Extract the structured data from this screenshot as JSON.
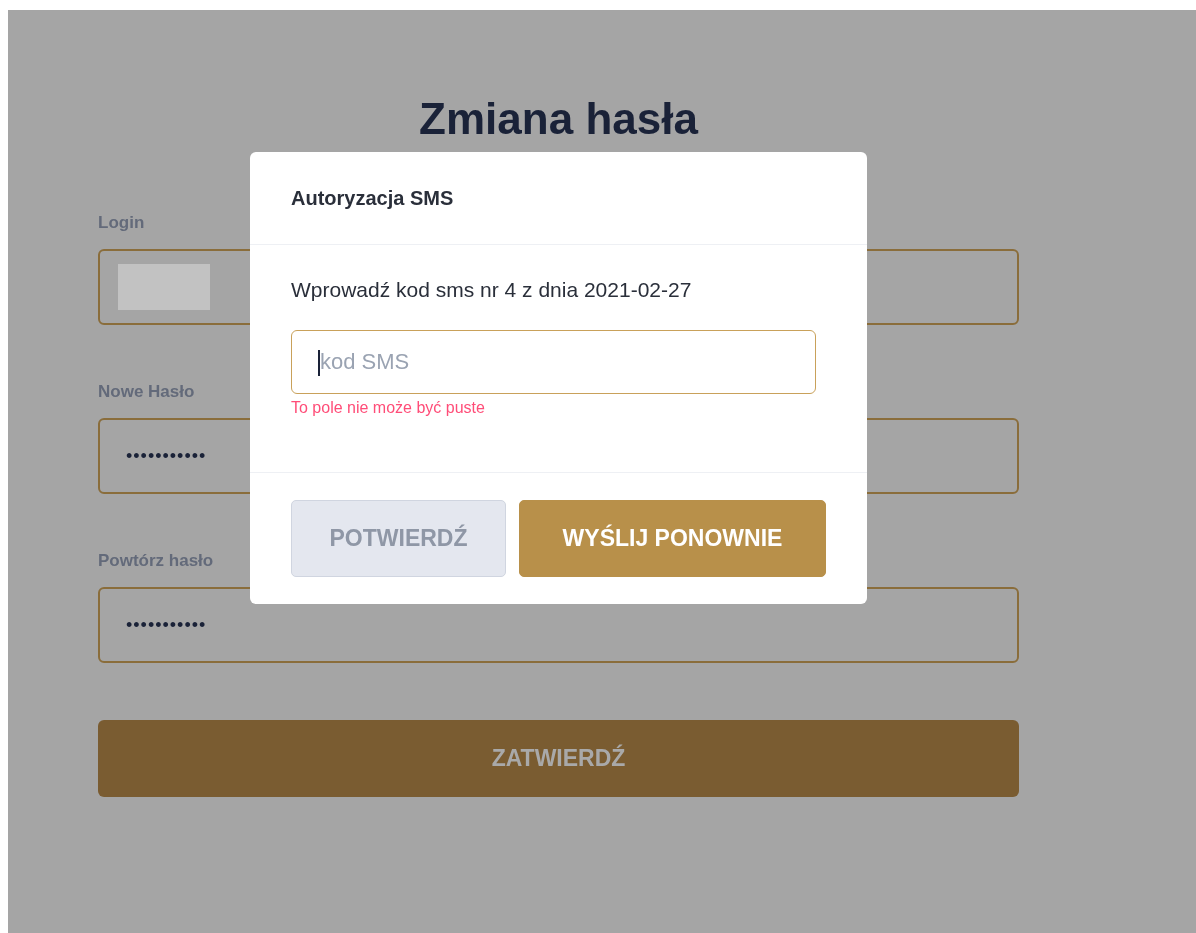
{
  "page": {
    "title": "Zmiana hasła",
    "fields": [
      {
        "label": "Login",
        "kind": "redacted"
      },
      {
        "label": "Nowe Hasło",
        "kind": "password",
        "value": "•••••••••••"
      },
      {
        "label": "Powtórz hasło",
        "kind": "password",
        "value": "•••••••••••"
      }
    ],
    "submit_button": {
      "label": "ZATWIERDŹ"
    }
  },
  "modal": {
    "title": "Autoryzacja SMS",
    "message": "Wprowadź kod sms nr 4 z dnia 2021-02-27",
    "code_field": {
      "placeholder": "kod SMS",
      "focused": true
    },
    "error": "To pole nie może być puste",
    "buttons": [
      {
        "label": "POTWIERDŹ",
        "disabled": true
      },
      {
        "label": "WYŚLIJ PONOWNIE",
        "disabled": false
      }
    ]
  }
}
